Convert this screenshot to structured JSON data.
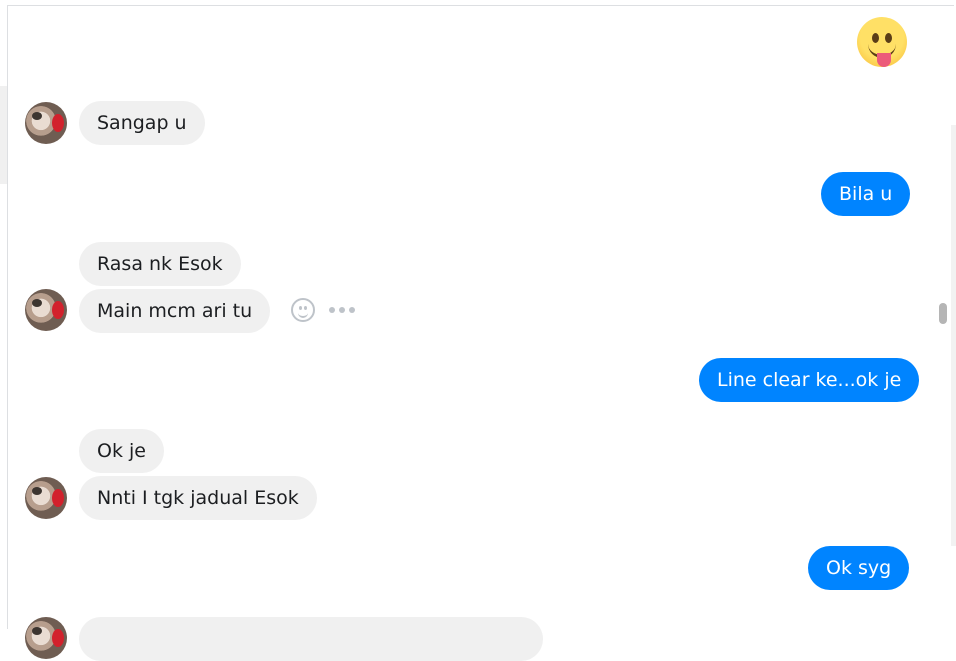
{
  "messages": {
    "m1_emoji": "😛",
    "m2": "Sangap u",
    "m3": "Bila u",
    "m4": "Rasa nk Esok",
    "m5": "Main mcm ari tu",
    "m6": "Line clear ke...ok je",
    "m7": "Ok je",
    "m8": "Nnti I tgk jadual Esok",
    "m9": "Ok syg",
    "m10": ""
  },
  "icons": {
    "react": "smiley-icon",
    "more": "more-dots-icon"
  },
  "colors": {
    "outgoing_bubble": "#0084ff",
    "incoming_bubble": "#f0f0f0",
    "scrollbar_thumb": "#b5b5b5"
  }
}
